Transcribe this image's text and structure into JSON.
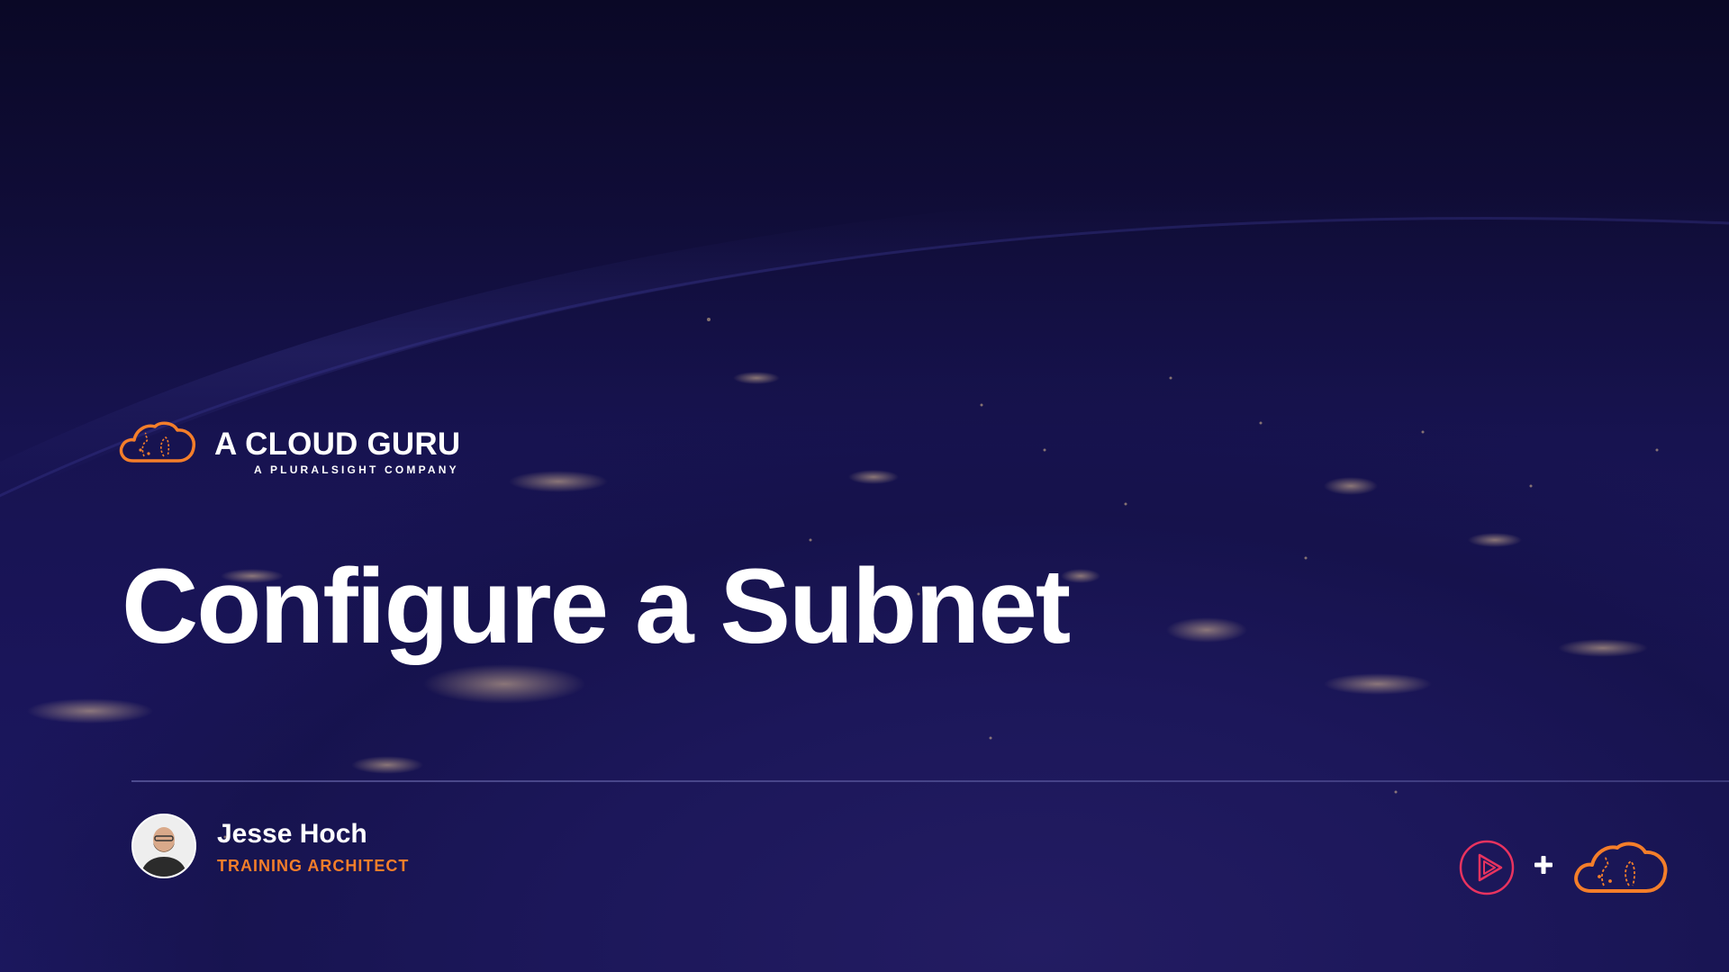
{
  "brand": {
    "name": "A CLOUD GURU",
    "tagline": "A PLURALSIGHT COMPANY"
  },
  "slide": {
    "title": "Configure a Subnet"
  },
  "presenter": {
    "name": "Jesse Hoch",
    "role": "TRAINING ARCHITECT"
  },
  "partner_logos": {
    "left_icon": "pluralsight-play-icon",
    "separator_icon": "plus-icon",
    "right_icon": "a-cloud-guru-cloud-icon"
  },
  "colors": {
    "accent_orange": "#f47e2a",
    "pluralsight_pink": "#e8335f",
    "background_navy": "#1a155a",
    "text_white": "#ffffff"
  },
  "background": {
    "image": "earth-at-night-from-orbit"
  }
}
